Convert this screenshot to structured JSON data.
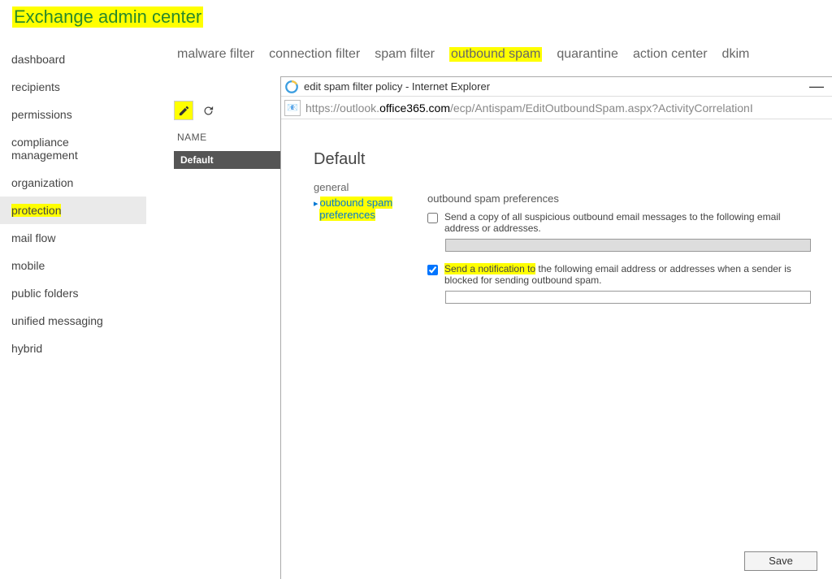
{
  "page_title": "Exchange admin center",
  "sidebar": {
    "items": [
      {
        "label": "dashboard"
      },
      {
        "label": "recipients"
      },
      {
        "label": "permissions"
      },
      {
        "label": "compliance management"
      },
      {
        "label": "organization"
      },
      {
        "label": "protection",
        "highlight": true,
        "active": true
      },
      {
        "label": "mail flow"
      },
      {
        "label": "mobile"
      },
      {
        "label": "public folders"
      },
      {
        "label": "unified messaging"
      },
      {
        "label": "hybrid"
      }
    ]
  },
  "tabs": [
    {
      "label": "malware filter"
    },
    {
      "label": "connection filter"
    },
    {
      "label": "spam filter"
    },
    {
      "label": "outbound spam",
      "highlight": true
    },
    {
      "label": "quarantine"
    },
    {
      "label": "action center"
    },
    {
      "label": "dkim"
    }
  ],
  "list": {
    "header": "NAME",
    "rows": [
      "Default"
    ]
  },
  "popup": {
    "window_title": "edit spam filter policy - Internet Explorer",
    "url_prefix": "https://",
    "url_host_gray": "outlook.",
    "url_host_black": "office365.com",
    "url_path": "/ecp/Antispam/EditOutboundSpam.aspx?ActivityCorrelationI",
    "policy_name": "Default",
    "nav": {
      "general": "general",
      "osp_line1": "outbound spam",
      "osp_line2": "preferences"
    },
    "prefs_title": "outbound spam preferences",
    "option1_label": "Send a copy of all suspicious outbound email messages to the following email address or addresses.",
    "option1_checked": false,
    "option1_value": "",
    "option2_hl": "Send a notification to",
    "option2_rest": " the following email address or addresses when a sender is blocked for sending outbound spam.",
    "option2_checked": true,
    "option2_value": "",
    "save_label": "Save"
  }
}
